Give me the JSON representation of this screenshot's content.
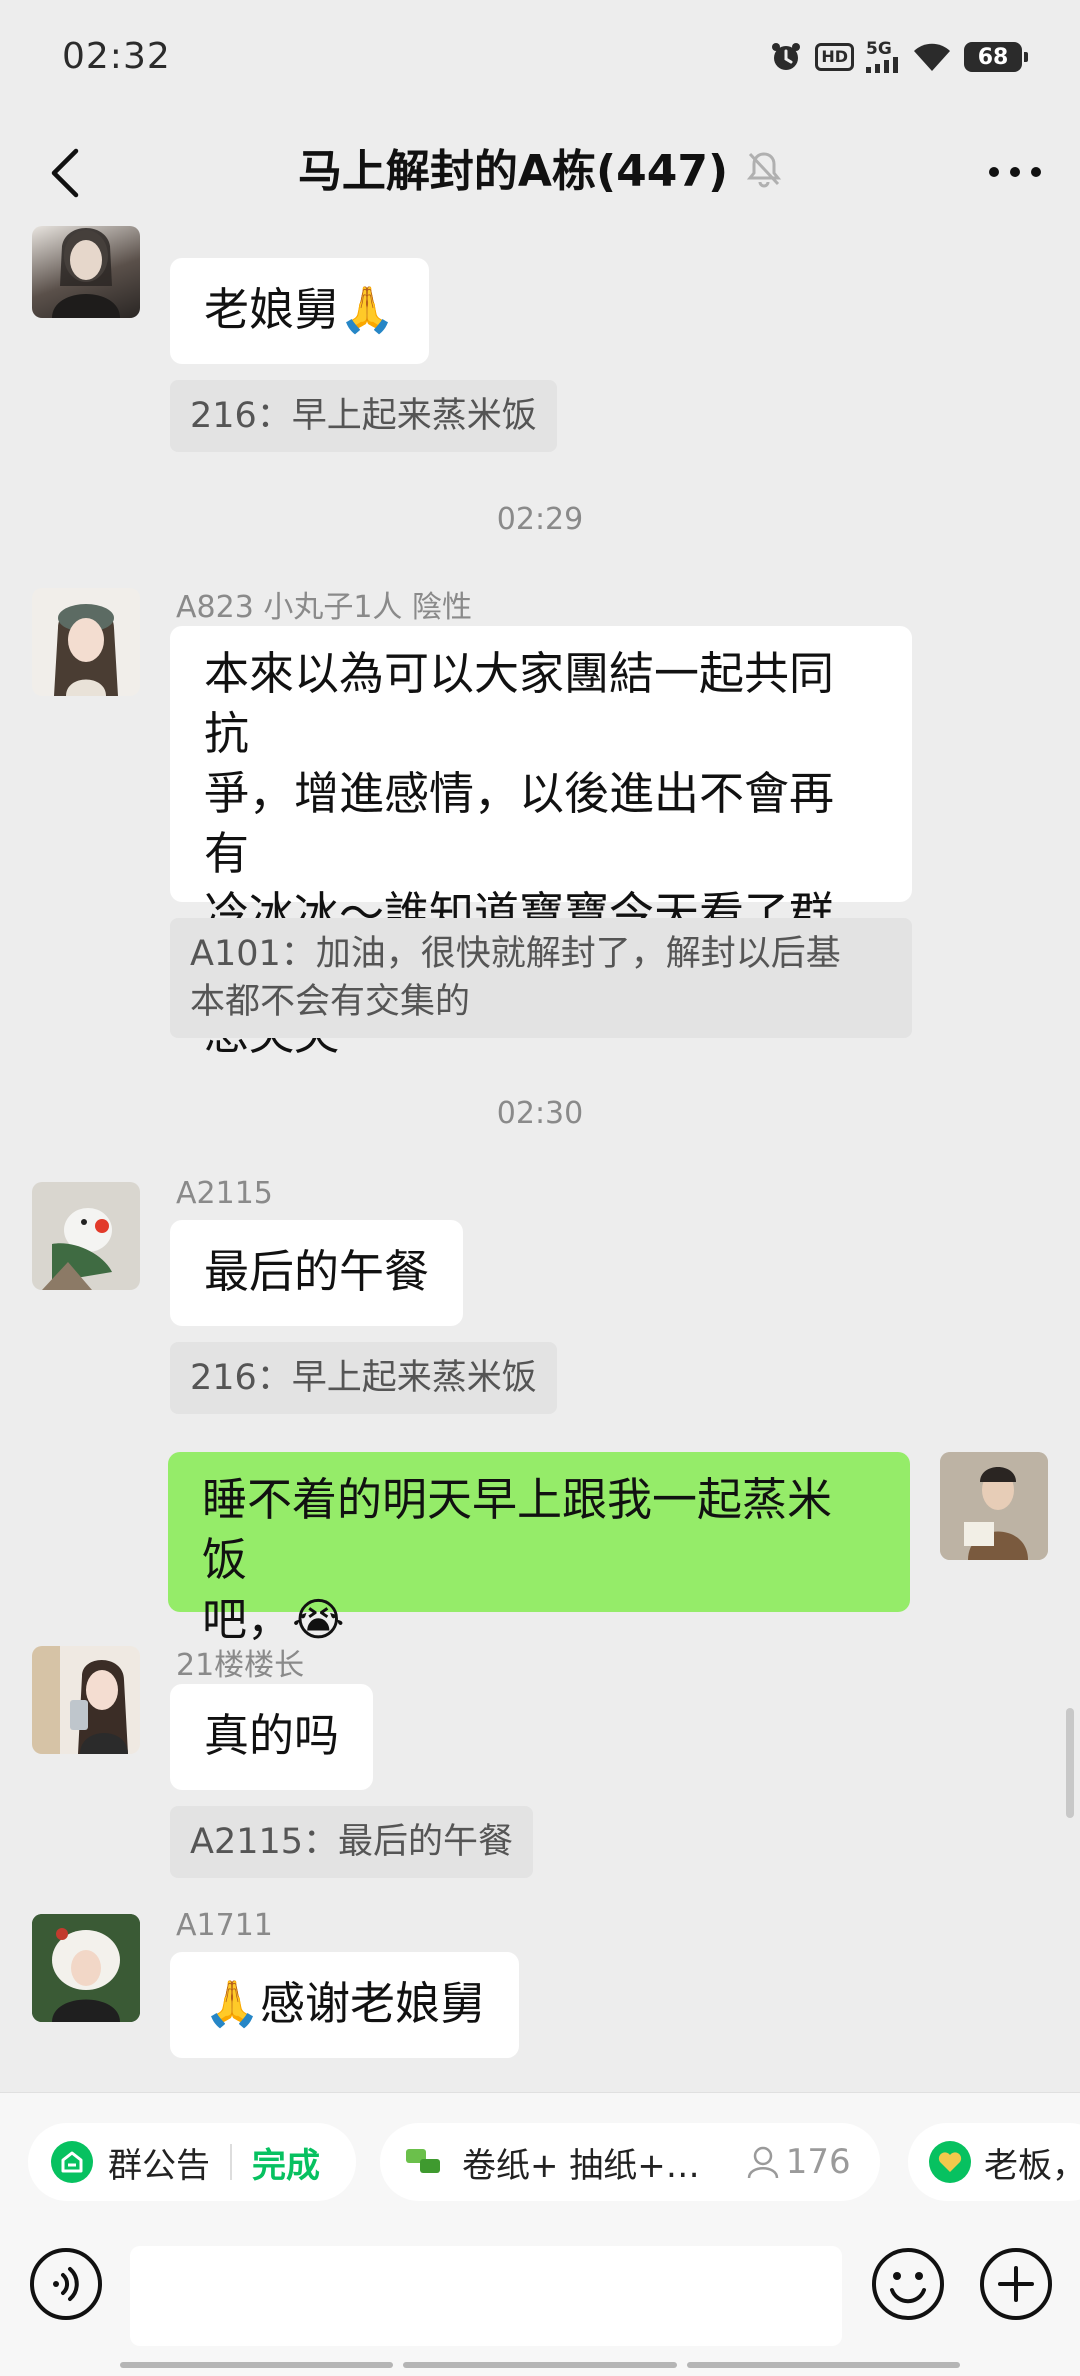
{
  "status_bar": {
    "time": "02:32",
    "hd_label": "HD",
    "network_label": "5G",
    "battery_level": "68"
  },
  "header": {
    "title": "马上解封的A栋(447)"
  },
  "messages": [
    {
      "type": "message",
      "sender": "",
      "bubble": "老娘舅🙏",
      "quote": "216：早上起来蒸米饭"
    },
    {
      "type": "time",
      "text": "02:29"
    },
    {
      "type": "message",
      "sender": "A823 小丸子1人 陰性",
      "bubble_lines": [
        "本來以為可以大家團結一起共同抗",
        "爭，增進感情，以後進出不會再有",
        "冷冰冰～誰知道寶寶今天看了群裡",
        "想哭哭"
      ],
      "quote_lines": [
        "A101：加油，很快就解封了，解封以后基",
        "本都不会有交集的"
      ]
    },
    {
      "type": "time",
      "text": "02:30"
    },
    {
      "type": "message",
      "sender": "A2115",
      "bubble": "最后的午餐",
      "quote": "216：早上起来蒸米饭"
    },
    {
      "type": "self",
      "bubble_lines": [
        "睡不着的明天早上跟我一起蒸米饭",
        "吧，😭"
      ]
    },
    {
      "type": "message",
      "sender": "21楼楼长",
      "bubble": "真的吗",
      "quote": "A2115：最后的午餐"
    },
    {
      "type": "message",
      "sender": "A1711",
      "bubble": "🙏感谢老娘舅"
    }
  ],
  "quick_bar": {
    "announcement_label": "群公告",
    "done_label": "完成",
    "item_label": "卷纸+ 抽纸+…",
    "member_count": "176",
    "boss_label": "老板，"
  },
  "input_bar": {
    "placeholder": ""
  },
  "colors": {
    "background": "#ededed",
    "self_bubble": "#95ec69",
    "accent_green": "#07c160"
  }
}
